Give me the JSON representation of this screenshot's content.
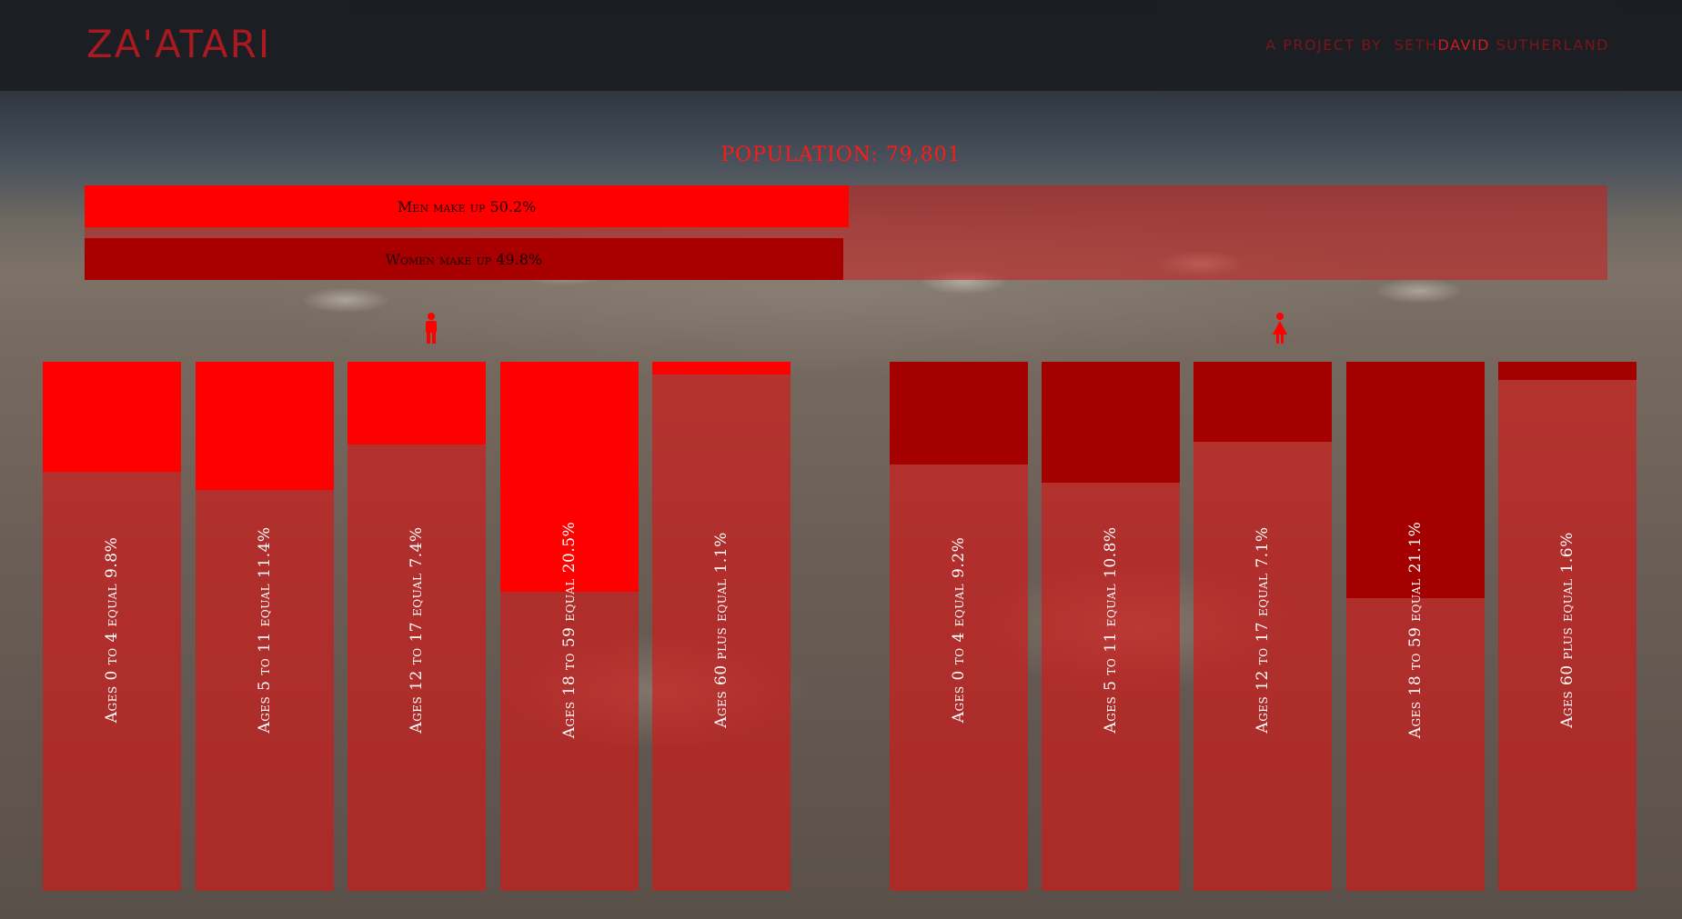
{
  "header": {
    "logo": "ZA'ATARI",
    "byline_prefix": "a project by",
    "byline_first": "seth",
    "byline_highlight": "david",
    "byline_last": "sutherland"
  },
  "colors": {
    "men": "#ff0000",
    "women": "#a50000",
    "accent": "#b01a1f"
  },
  "chart_data": {
    "type": "bar",
    "title": "POPULATION: 79,801",
    "gender": [
      {
        "label": "Men make up 50.2%",
        "value": 50.2
      },
      {
        "label": "Women make up 49.8%",
        "value": 49.8
      }
    ],
    "series": [
      {
        "group": "men",
        "categories": [
          "Ages 0 to 4",
          "Ages 5 to 11",
          "Ages 12 to 17",
          "Ages 18 to 59",
          "Ages 60 plus"
        ],
        "values": [
          9.8,
          11.4,
          7.4,
          20.5,
          1.1
        ],
        "labels": [
          "Ages 0 to 4 equal 9.8%",
          "Ages 5 to 11 equal 11.4%",
          "Ages 12 to 17 equal 7.4%",
          "Ages 18 to 59 equal 20.5%",
          "Ages 60 plus equal 1.1%"
        ]
      },
      {
        "group": "women",
        "categories": [
          "Ages 0 to 4",
          "Ages 5 to 11",
          "Ages 12 to 17",
          "Ages 18 to 59",
          "Ages 60 plus"
        ],
        "values": [
          9.2,
          10.8,
          7.1,
          21.1,
          1.6
        ],
        "labels": [
          "Ages 0 to 4 equal 9.2%",
          "Ages 5 to 11 equal 10.8%",
          "Ages 12 to 17 equal 7.1%",
          "Ages 18 to 59 equal 21.1%",
          "Ages 60 plus equal 1.6%"
        ]
      }
    ],
    "ylim": [
      0,
      100
    ]
  }
}
